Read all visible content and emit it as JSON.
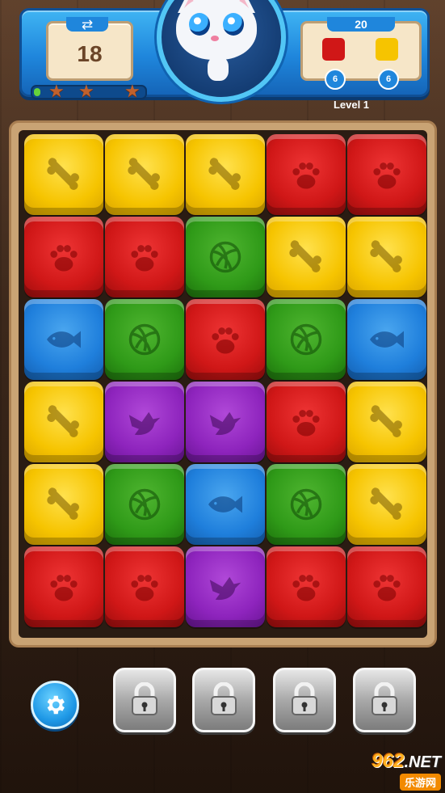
{
  "hud": {
    "moves": "18",
    "target": "20",
    "level": "Level 1",
    "progress": 0.05,
    "stars": 3,
    "goals": [
      {
        "color": "#d01717",
        "count": "6"
      },
      {
        "color": "#f6c400",
        "count": "6"
      }
    ]
  },
  "board": {
    "rows": [
      [
        "yellow-bone",
        "yellow-bone",
        "yellow-bone",
        "red-paw",
        "red-paw"
      ],
      [
        "red-paw",
        "red-paw",
        "green-ball",
        "yellow-bone",
        "yellow-bone"
      ],
      [
        "blue-fish",
        "green-ball",
        "red-paw",
        "green-ball",
        "blue-fish"
      ],
      [
        "yellow-bone",
        "purple-bird",
        "purple-bird",
        "red-paw",
        "yellow-bone"
      ],
      [
        "yellow-bone",
        "green-ball",
        "blue-fish",
        "green-ball",
        "yellow-bone"
      ],
      [
        "red-paw",
        "red-paw",
        "purple-bird",
        "red-paw",
        "red-paw"
      ]
    ]
  },
  "bottom": {
    "settings_icon": "gear-icon",
    "boosters": [
      "lock-icon",
      "lock-icon",
      "lock-icon",
      "lock-icon"
    ]
  },
  "watermark": {
    "brand": "962",
    "suffix": ".NET",
    "sub": "乐游网"
  }
}
